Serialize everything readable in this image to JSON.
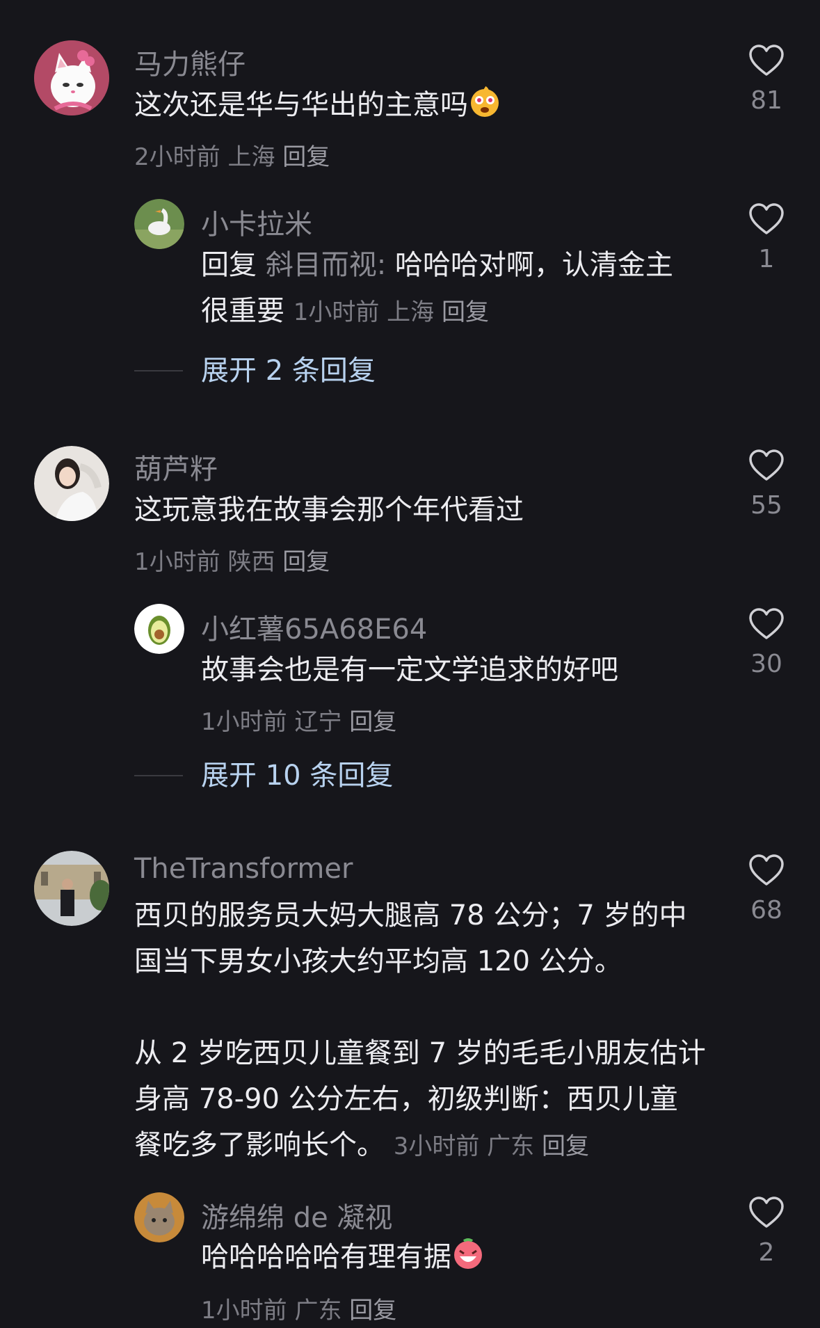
{
  "comments": [
    {
      "username": "马力熊仔",
      "text": "这次还是华与华出的主意吗",
      "time": "2小时前",
      "location": "上海",
      "reply_label": "回复",
      "likes": "81",
      "reply": {
        "username": "小卡拉米",
        "prefix": "回复",
        "reply_to": "斜目而视:",
        "text_line1": "哈哈哈对啊，认清金主",
        "text_line2": "很重要",
        "time": "1小时前",
        "location": "上海",
        "reply_label": "回复",
        "likes": "1"
      },
      "expand": "展开 2 条回复"
    },
    {
      "username": "葫芦籽",
      "text": "这玩意我在故事会那个年代看过",
      "time": "1小时前",
      "location": "陕西",
      "reply_label": "回复",
      "likes": "55",
      "reply": {
        "username": "小红薯65A68E64",
        "text": "故事会也是有一定文学追求的好吧",
        "time": "1小时前",
        "location": "辽宁",
        "reply_label": "回复",
        "likes": "30"
      },
      "expand": "展开 10 条回复"
    },
    {
      "username": "TheTransformer",
      "text_line1": "西贝的服务员大妈大腿高 78 公分；7 岁的中",
      "text_line2": "国当下男女小孩大约平均高 120 公分。",
      "text_line3": "从 2 岁吃西贝儿童餐到 7 岁的毛毛小朋友估计",
      "text_line4": "身高 78-90 公分左右，初级判断：西贝儿童",
      "text_line5": "餐吃多了影响长个。",
      "time": "3小时前",
      "location": "广东",
      "reply_label": "回复",
      "likes": "68",
      "reply": {
        "username": "游绵绵 de 凝视",
        "text": "哈哈哈哈哈有理有据",
        "time": "1小时前",
        "location": "广东",
        "reply_label": "回复",
        "likes": "2"
      }
    }
  ],
  "colors": {
    "background": "#16161b",
    "username": "#8a8a92",
    "text": "#ececf0",
    "expand": "#b8d2ef"
  },
  "icons": [
    "heart-icon",
    "cat-avatar",
    "goose-avatar",
    "girl-avatar",
    "avocado-avatar",
    "man-avatar",
    "cat2-avatar",
    "surprised-emoji",
    "laughing-emoji"
  ]
}
